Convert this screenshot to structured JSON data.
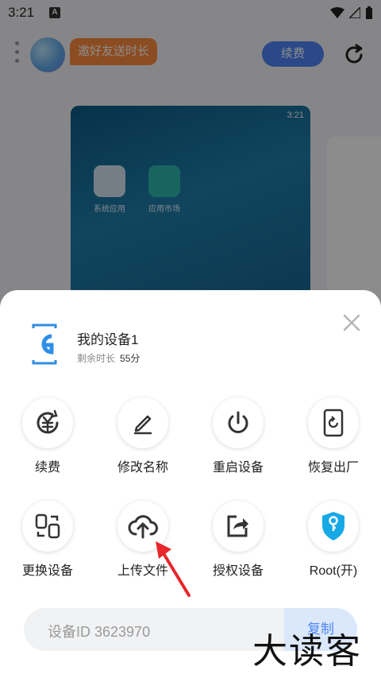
{
  "status": {
    "time": "3:21",
    "notif_letter": "A"
  },
  "header": {
    "invite_label": "邀好友送时长",
    "renew_label": "续费"
  },
  "preview": {
    "time": "3:21",
    "apps": [
      {
        "label": "系统应用"
      },
      {
        "label": "应用市场"
      }
    ]
  },
  "sheet": {
    "device_name": "我的设备1",
    "remaining_label": "剩余时长",
    "remaining_value": "55分",
    "actions": [
      {
        "label": "续费",
        "icon": "renew-icon"
      },
      {
        "label": "修改名称",
        "icon": "edit-icon"
      },
      {
        "label": "重启设备",
        "icon": "power-icon"
      },
      {
        "label": "恢复出厂",
        "icon": "factory-reset-icon"
      },
      {
        "label": "更换设备",
        "icon": "swap-device-icon"
      },
      {
        "label": "上传文件",
        "icon": "cloud-upload-icon"
      },
      {
        "label": "授权设备",
        "icon": "share-icon"
      },
      {
        "label": "Root(开)",
        "icon": "root-key-icon"
      }
    ],
    "root_badge": "ON",
    "device_id_text": "设备ID 3623970",
    "copy_label": "复制"
  },
  "watermark": "大读客",
  "colors": {
    "accent": "#4f86f7",
    "orange": "#ff8a3d",
    "root": "#17a9e6"
  }
}
